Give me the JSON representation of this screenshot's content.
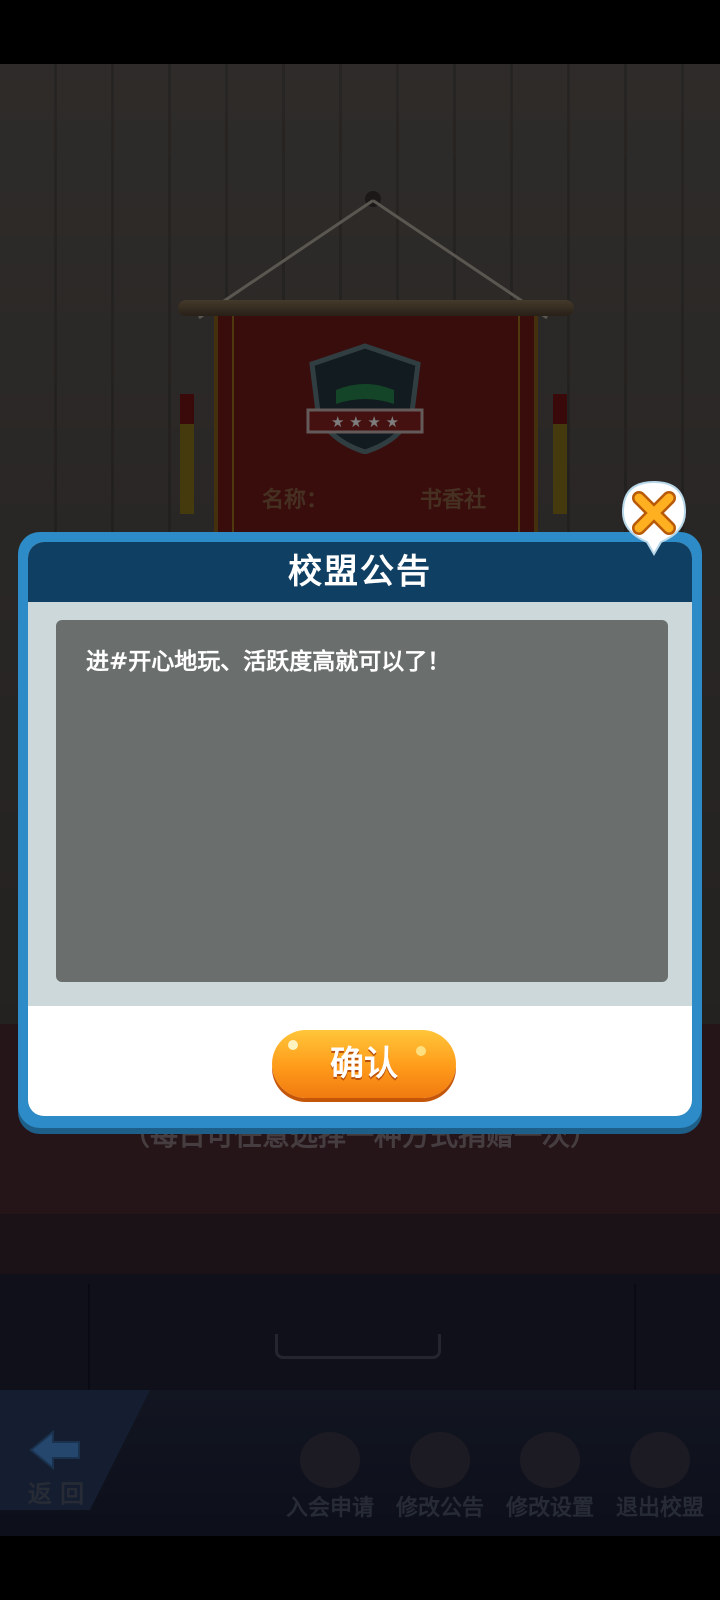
{
  "scene": {
    "banner_name_label": "名称：",
    "banner_name_value": "书香社",
    "donate_note": "（每日可任意选择一种方式捐赠一次）"
  },
  "bottom_bar": {
    "back_label": "返 回",
    "items": [
      {
        "label": "入会申请",
        "icon": "application-icon"
      },
      {
        "label": "修改公告",
        "icon": "edit-notice-icon"
      },
      {
        "label": "修改设置",
        "icon": "settings-gear-icon"
      },
      {
        "label": "退出校盟",
        "icon": "exit-icon"
      }
    ]
  },
  "modal": {
    "title": "校盟公告",
    "notice_text": "进#开心地玩、活跃度高就可以了！",
    "confirm_label": "确认",
    "close_icon": "close-icon"
  },
  "colors": {
    "modal_border": "#2d8bc7",
    "modal_header": "#0f3f62",
    "notice_box": "#6a6e6c",
    "confirm_button": "#ff9a1a",
    "close_icon": "#f08a10"
  }
}
